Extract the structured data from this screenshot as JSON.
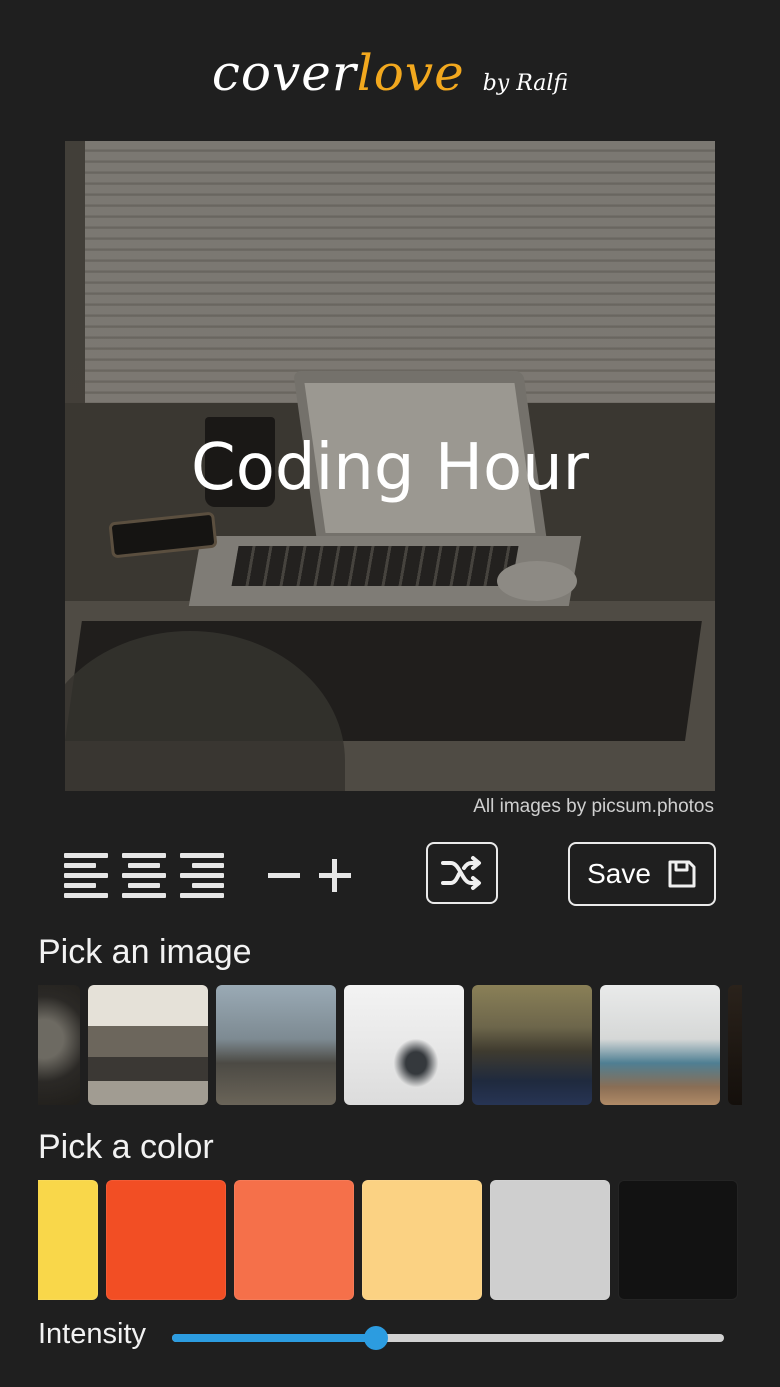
{
  "header": {
    "logo_part1": "cover",
    "logo_part2": "love",
    "byline": "by Ralfi"
  },
  "preview": {
    "cover_text": "Coding Hour",
    "text_color": "#ffffff"
  },
  "credit": "All images by picsum.photos",
  "toolbar": {
    "align_left_icon": "align-left-icon",
    "align_center_icon": "align-center-icon",
    "align_right_icon": "align-right-icon",
    "decrease_icon": "minus-icon",
    "increase_icon": "plus-icon",
    "shuffle_icon": "shuffle-icon",
    "save_label": "Save",
    "save_icon": "floppy-disk-icon"
  },
  "image_picker": {
    "title": "Pick an image",
    "thumbnails": [
      "partial-dark",
      "desk-laptop",
      "legs-rocks",
      "foggy-peak",
      "mountain-dusk",
      "coastal-cliffs",
      "partial-dark"
    ]
  },
  "color_picker": {
    "title": "Pick a color",
    "colors": [
      "#f9d74a",
      "#f24e24",
      "#f5704a",
      "#fbd283",
      "#cfcfcf",
      "#121212"
    ]
  },
  "intensity": {
    "label": "Intensity",
    "value": 0.37,
    "accent_color": "#2c9ce0"
  }
}
